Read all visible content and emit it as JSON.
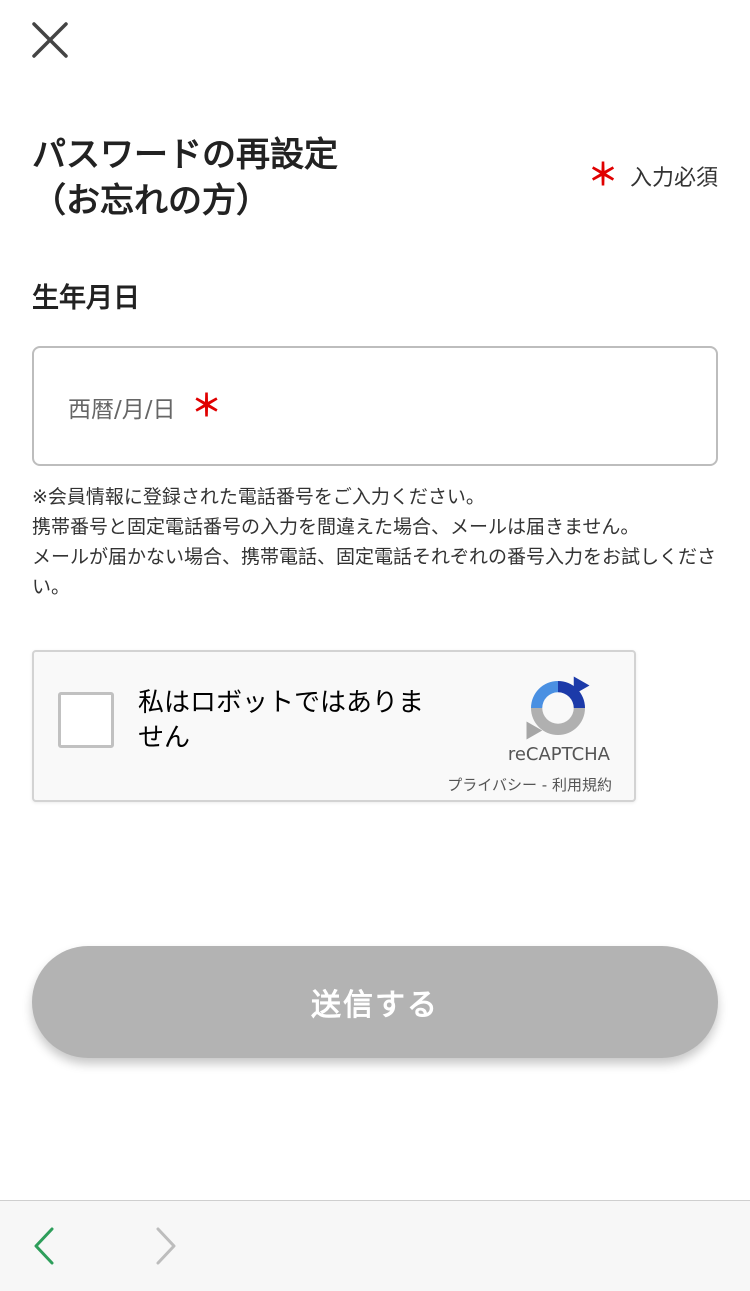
{
  "header": {
    "close_icon": "close-icon"
  },
  "page": {
    "title_line1": "パスワードの再設定",
    "title_line2": "（お忘れの方）",
    "required_mark": "＊",
    "required_label": "入力必須"
  },
  "birthdate": {
    "label": "生年月日",
    "placeholder": "西暦/月/日",
    "required_mark": "＊",
    "value": ""
  },
  "note": {
    "line1": "※会員情報に登録された電話番号をご入力ください。",
    "line2": "携帯番号と固定電話番号の入力を間違えた場合、メールは届きません。",
    "line3": "メールが届かない場合、携帯電話、固定電話それぞれの番号入力をお試しください。"
  },
  "recaptcha": {
    "label": "私はロボットではありません",
    "brand": "reCAPTCHA",
    "privacy": "プライバシー",
    "separator": "-",
    "terms": "利用規約",
    "checked": false
  },
  "submit": {
    "label": "送信する"
  },
  "browser_nav": {
    "back_icon": "chevron-left-icon",
    "forward_icon": "chevron-right-icon",
    "back_color": "#2e9e5b",
    "forward_color": "#bdbdbd"
  },
  "colors": {
    "required": "#e00000",
    "button_disabled": "#b3b3b3"
  }
}
